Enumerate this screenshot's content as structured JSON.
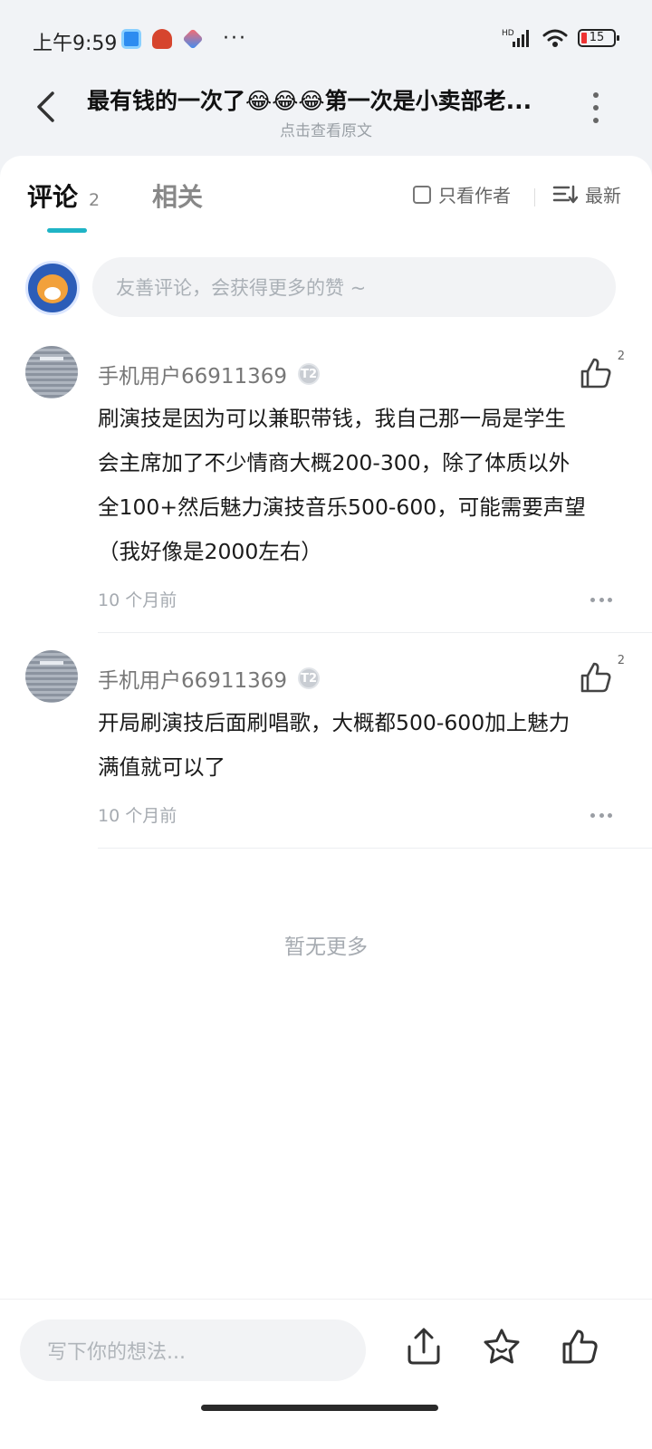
{
  "status_bar": {
    "time": "上午9:59",
    "more": "···",
    "battery": "15",
    "network": "HD"
  },
  "header": {
    "title": "最有钱的一次了😂😂😂第一次是小卖部老...",
    "subtitle": "点击查看原文"
  },
  "tabs": {
    "comments_label": "评论",
    "comments_count": "2",
    "related_label": "相关",
    "author_only_label": "只看作者",
    "sort_label": "最新"
  },
  "composer": {
    "placeholder": "友善评论，会获得更多的赞 ~"
  },
  "comments": [
    {
      "user": "手机用户66911369",
      "level": "T2",
      "likes": "2",
      "text_lines": [
        "刷演技是因为可以兼职带钱，我自己那一局是学生",
        "会主席加了不少情商大概200-300，除了体质以外",
        "全100+然后魅力演技音乐500-600，可能需要声望",
        "（我好像是2000左右）"
      ],
      "time": "10 个月前"
    },
    {
      "user": "手机用户66911369",
      "level": "T2",
      "likes": "2",
      "text_lines": [
        "开局刷演技后面刷唱歌，大概都500-600加上魅力",
        "满值就可以了"
      ],
      "time": "10 个月前"
    }
  ],
  "footer_note": "暂无更多",
  "bottom_bar": {
    "placeholder": "写下你的想法...",
    "icons": [
      "share-icon",
      "star-icon",
      "like-icon"
    ]
  },
  "colors": {
    "accent": "#1fb4c6",
    "background": "#f1f3f6"
  }
}
